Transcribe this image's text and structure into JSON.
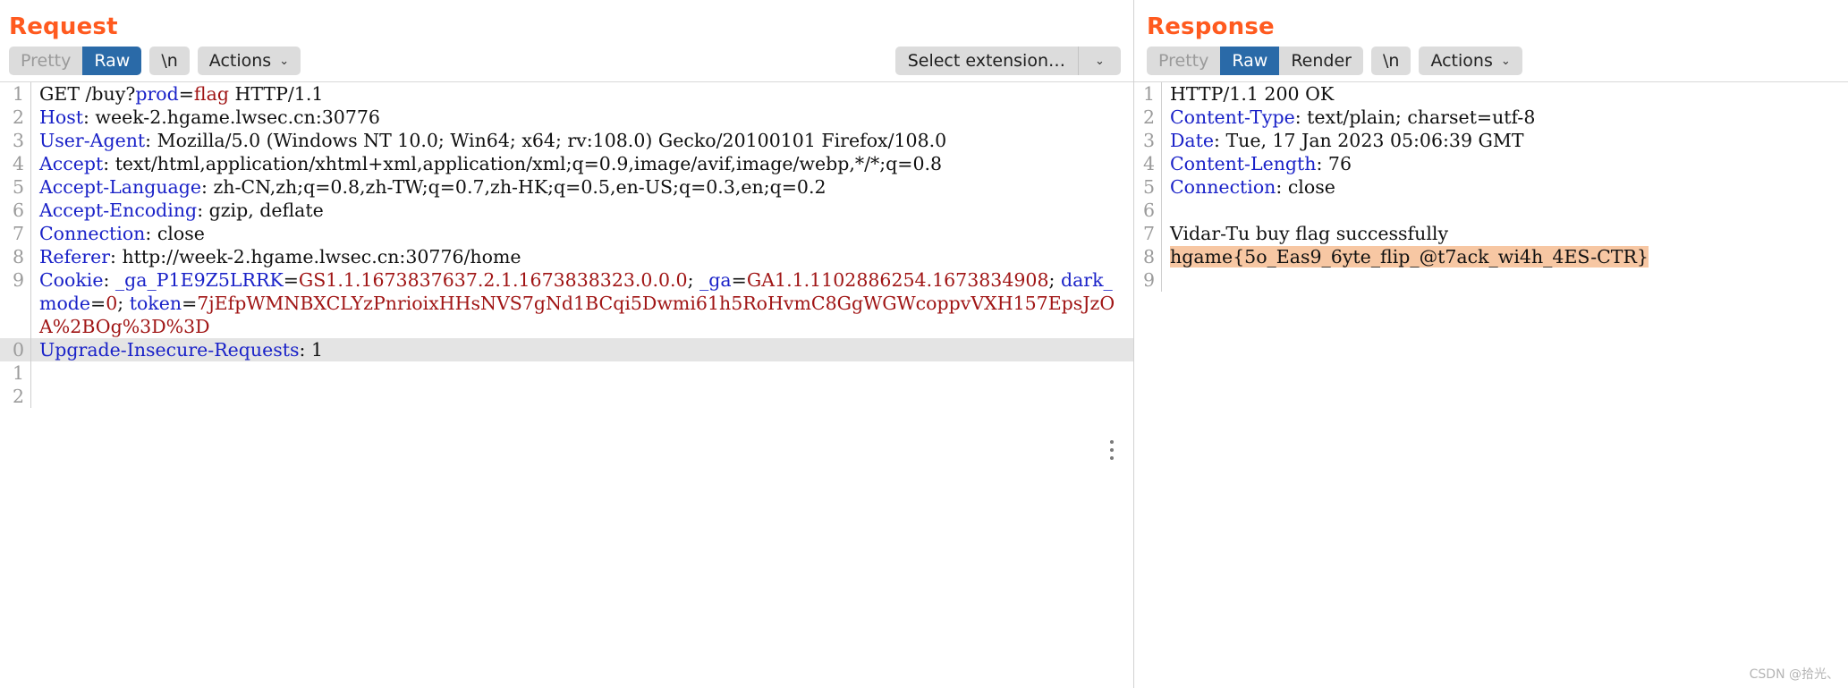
{
  "request": {
    "title": "Request",
    "tabs": [
      {
        "label": "Pretty",
        "state": "inactive"
      },
      {
        "label": "Raw",
        "state": "active"
      }
    ],
    "newline_button": "\\n",
    "actions_button": "Actions",
    "chevron": "⌄",
    "extension_select": {
      "value": "Select extension…",
      "arrow": "⌄"
    },
    "lines": [
      {
        "n": "1",
        "segments": [
          {
            "t": "GET /buy?",
            "c": "val"
          },
          {
            "t": "prod",
            "c": "blu"
          },
          {
            "t": "=",
            "c": "val"
          },
          {
            "t": "flag",
            "c": "red"
          },
          {
            "t": " HTTP/1.1",
            "c": "val"
          }
        ]
      },
      {
        "n": "2",
        "segments": [
          {
            "t": "Host",
            "c": "hdr"
          },
          {
            "t": ": week-2.hgame.lwsec.cn:30776",
            "c": "val"
          }
        ]
      },
      {
        "n": "3",
        "segments": [
          {
            "t": "User-Agent",
            "c": "hdr"
          },
          {
            "t": ": Mozilla/5.0 (Windows NT 10.0; Win64; x64; rv:108.0) Gecko/20100101 Firefox/108.0",
            "c": "val"
          }
        ]
      },
      {
        "n": "4",
        "segments": [
          {
            "t": "Accept",
            "c": "hdr"
          },
          {
            "t": ": text/html,application/xhtml+xml,application/xml;q=0.9,image/avif,image/webp,*/*;q=0.8",
            "c": "val"
          }
        ]
      },
      {
        "n": "5",
        "segments": [
          {
            "t": "Accept-Language",
            "c": "hdr"
          },
          {
            "t": ": zh-CN,zh;q=0.8,zh-TW;q=0.7,zh-HK;q=0.5,en-US;q=0.3,en;q=0.2",
            "c": "val"
          }
        ]
      },
      {
        "n": "6",
        "segments": [
          {
            "t": "Accept-Encoding",
            "c": "hdr"
          },
          {
            "t": ": gzip, deflate",
            "c": "val"
          }
        ]
      },
      {
        "n": "7",
        "segments": [
          {
            "t": "Connection",
            "c": "hdr"
          },
          {
            "t": ": close",
            "c": "val"
          }
        ]
      },
      {
        "n": "8",
        "segments": [
          {
            "t": "Referer",
            "c": "hdr"
          },
          {
            "t": ": http://week-2.hgame.lwsec.cn:30776/home",
            "c": "val"
          }
        ]
      },
      {
        "n": "9",
        "segments": [
          {
            "t": "Cookie",
            "c": "hdr"
          },
          {
            "t": ": ",
            "c": "val"
          },
          {
            "t": "_ga_P1E9Z5LRRK",
            "c": "blu"
          },
          {
            "t": "=",
            "c": "val"
          },
          {
            "t": "GS1.1.1673837637.2.1.1673838323.0.0.0",
            "c": "red"
          },
          {
            "t": "; ",
            "c": "val"
          },
          {
            "t": "_ga",
            "c": "blu"
          },
          {
            "t": "=",
            "c": "val"
          },
          {
            "t": "GA1.1.1102886254.1673834908",
            "c": "red"
          },
          {
            "t": "; ",
            "c": "val"
          },
          {
            "t": "dark_mode",
            "c": "blu"
          },
          {
            "t": "=",
            "c": "val"
          },
          {
            "t": "0",
            "c": "red"
          },
          {
            "t": "; ",
            "c": "val"
          },
          {
            "t": "token",
            "c": "blu"
          },
          {
            "t": "=",
            "c": "val"
          },
          {
            "t": "7jEfpWMNBXCLYzPnrioixHHsNVS7gNd1BCqi5Dwmi61h5RoHvmC8GgWGWcoppvVXH157EpsJzOA%2BOg%3D%3D",
            "c": "red"
          }
        ]
      },
      {
        "n": "0",
        "segments": [
          {
            "t": "Upgrade-Insecure-Requests",
            "c": "hdr"
          },
          {
            "t": ": 1",
            "c": "val"
          }
        ]
      },
      {
        "n": "1",
        "segments": []
      },
      {
        "n": "2",
        "segments": []
      }
    ],
    "highlighted_line_index": 9,
    "grip_icon": "drag-handle-dots"
  },
  "response": {
    "title": "Response",
    "tabs": [
      {
        "label": "Pretty",
        "state": "inactive"
      },
      {
        "label": "Raw",
        "state": "active"
      },
      {
        "label": "Render",
        "state": "normal"
      }
    ],
    "newline_button": "\\n",
    "actions_button": "Actions",
    "chevron": "⌄",
    "lines": [
      {
        "n": "1",
        "segments": [
          {
            "t": "HTTP/1.1 200 OK",
            "c": "val"
          }
        ]
      },
      {
        "n": "2",
        "segments": [
          {
            "t": "Content-Type",
            "c": "hdr"
          },
          {
            "t": ": text/plain; charset=utf-8",
            "c": "val"
          }
        ]
      },
      {
        "n": "3",
        "segments": [
          {
            "t": "Date",
            "c": "hdr"
          },
          {
            "t": ": Tue, 17 Jan 2023 05:06:39 GMT",
            "c": "val"
          }
        ]
      },
      {
        "n": "4",
        "segments": [
          {
            "t": "Content-Length",
            "c": "hdr"
          },
          {
            "t": ": 76",
            "c": "val"
          }
        ]
      },
      {
        "n": "5",
        "segments": [
          {
            "t": "Connection",
            "c": "hdr"
          },
          {
            "t": ": close",
            "c": "val"
          }
        ]
      },
      {
        "n": "6",
        "segments": []
      },
      {
        "n": "7",
        "segments": [
          {
            "t": "Vidar-Tu buy flag successfully",
            "c": "val"
          }
        ]
      },
      {
        "n": "8",
        "segments": [
          {
            "t": "hgame{5o_Eas9_6yte_flip_@t7ack_wi4h_4ES-CTR}",
            "c": "val flag-hl"
          }
        ]
      },
      {
        "n": "9",
        "segments": []
      }
    ]
  },
  "watermark": "CSDN @拾光、",
  "colors": {
    "accent": "#ff5a1f",
    "active_tab": "#2a6aa8",
    "header_name": "#1a22c8",
    "cookie_value": "#a01515",
    "flag_highlight": "#f7c7a3",
    "line_highlight": "#e4e4e4"
  }
}
